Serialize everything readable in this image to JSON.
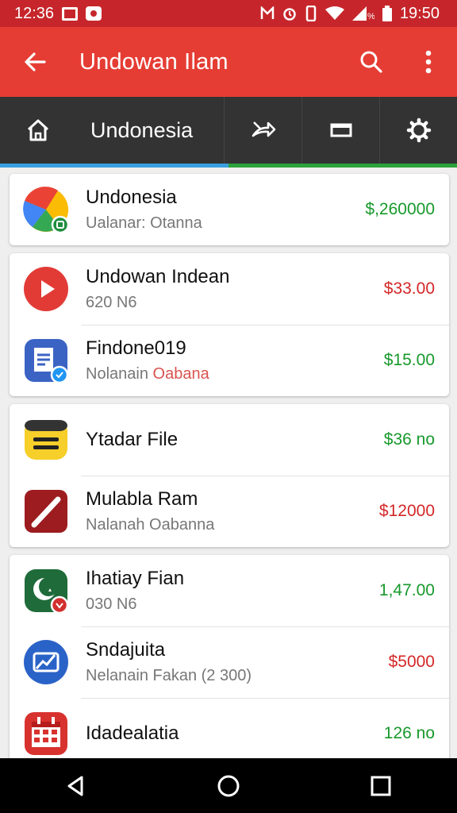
{
  "status_bar": {
    "time_left": "12:36",
    "time_right": "19:50"
  },
  "app_bar": {
    "title": "Undowan Ilam"
  },
  "toolbar": {
    "title": "Undonesia"
  },
  "progress": {
    "value": 0.5
  },
  "cards": [
    {
      "rows": [
        {
          "title": "Undonesia",
          "subtitle": "Ualanar: Otanna",
          "price": "$,260000",
          "price_color": "#17992b",
          "icon": "google-drive-icon"
        }
      ]
    },
    {
      "rows": [
        {
          "title": "Undowan Indean",
          "subtitle": "620 N6",
          "price": "$33.00",
          "price_color": "#d42727",
          "icon": "youtube-play-icon"
        },
        {
          "title": "Findone019",
          "subtitle": "Nolanain",
          "subtitle_accent": "Oabana",
          "price": "$15.00",
          "price_color": "#17992b",
          "icon": "document-icon"
        }
      ]
    },
    {
      "rows": [
        {
          "title": "Ytadar File",
          "subtitle": "",
          "price": "$36 no",
          "price_color": "#17992b",
          "icon": "file-icon"
        },
        {
          "title": "Mulabla Ram",
          "subtitle": "Nalanah Oabanna",
          "price": "$12000",
          "price_color": "#d42727",
          "icon": "pencil-icon"
        }
      ]
    },
    {
      "rows": [
        {
          "title": "Ihatiay Fian",
          "subtitle": "030 N6",
          "price": "1,47.00",
          "price_color": "#17992b",
          "icon": "crescent-icon"
        },
        {
          "title": "Sndajuita",
          "subtitle": "Nelanain Fakan (2 300)",
          "price": "$5000",
          "price_color": "#d42727",
          "icon": "chart-icon"
        },
        {
          "title": "Idadealatia",
          "subtitle": "",
          "price": "126 no",
          "price_color": "#17992b",
          "icon": "calendar-icon"
        }
      ]
    }
  ]
}
